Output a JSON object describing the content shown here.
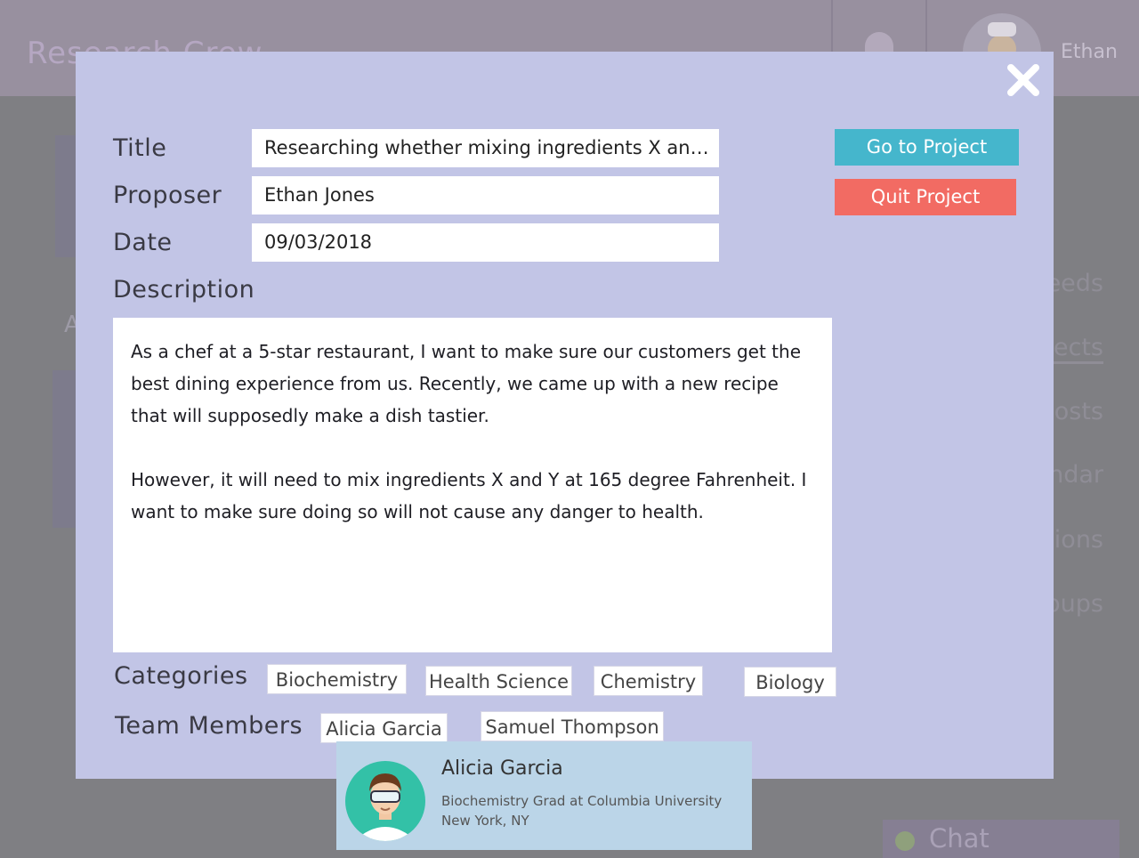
{
  "app": {
    "brand": "Research Crew",
    "user_name": "Ethan"
  },
  "background": {
    "side_nav": [
      "eeds",
      "ects",
      "osts",
      "ndar",
      "ions",
      "oups"
    ],
    "left_text": "A",
    "chat_label": "Chat"
  },
  "modal": {
    "labels": {
      "title": "Title",
      "proposer": "Proposer",
      "date": "Date",
      "description": "Description",
      "categories": "Categories",
      "team_members": "Team Members"
    },
    "values": {
      "title": "Researching whether mixing ingredients X and...",
      "proposer": "Ethan Jones",
      "date": "09/03/2018"
    },
    "description_paragraphs": [
      "As a chef at a 5-star restaurant, I want to make sure our customers get the best dining experience from us. Recently, we came up with a new recipe that will supposedly make a dish tastier.",
      "However, it will need to mix ingredients X and Y at 165 degree Fahrenheit. I want to make sure doing so will not cause any danger to health."
    ],
    "categories": [
      "Biochemistry",
      "Health Science",
      "Chemistry",
      "Biology"
    ],
    "team_members": [
      "Alicia Garcia",
      "Samuel Thompson"
    ],
    "buttons": {
      "go_to_project": "Go to Project",
      "quit_project": "Quit Project"
    },
    "colors": {
      "go_to_project": "#45b6cc",
      "quit_project": "#f26b63",
      "modal_bg": "#c2c5e6"
    }
  },
  "member_card": {
    "name": "Alicia Garcia",
    "line1": "Biochemistry Grad at Columbia University",
    "line2": "New York, NY"
  }
}
